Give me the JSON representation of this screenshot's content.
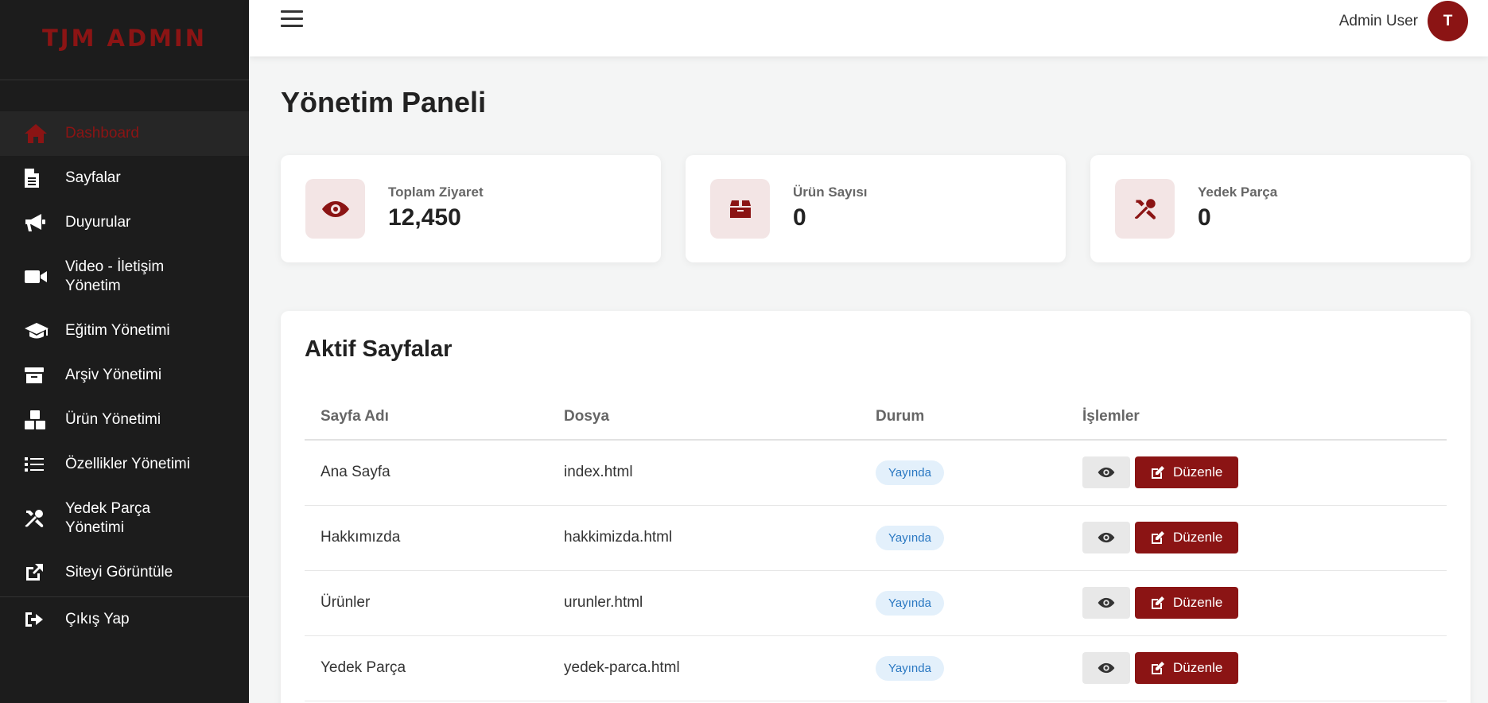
{
  "brand": "TJM ADMIN",
  "sidebar": {
    "items": [
      {
        "label": "Dashboard",
        "icon": "home-icon"
      },
      {
        "label": "Sayfalar",
        "icon": "file-icon"
      },
      {
        "label": "Duyurular",
        "icon": "megaphone-icon"
      },
      {
        "label": "Video - İletişim Yönetim",
        "icon": "video-icon"
      },
      {
        "label": "Eğitim Yönetimi",
        "icon": "graduation-cap-icon"
      },
      {
        "label": "Arşiv Yönetimi",
        "icon": "archive-icon"
      },
      {
        "label": "Ürün Yönetimi",
        "icon": "boxes-icon"
      },
      {
        "label": "Özellikler Yönetimi",
        "icon": "list-icon"
      },
      {
        "label": "Yedek Parça Yönetimi",
        "icon": "tools-icon"
      },
      {
        "label": "Siteyi Görüntüle",
        "icon": "external-link-icon"
      },
      {
        "label": "Çıkış Yap",
        "icon": "sign-out-icon"
      }
    ]
  },
  "header": {
    "user_name": "Admin User",
    "avatar_initial": "T"
  },
  "page_title": "Yönetim Paneli",
  "stats": [
    {
      "label": "Toplam Ziyaret",
      "value": "12,450",
      "icon": "eye-icon"
    },
    {
      "label": "Ürün Sayısı",
      "value": "0",
      "icon": "box-icon"
    },
    {
      "label": "Yedek Parça",
      "value": "0",
      "icon": "tools-icon"
    }
  ],
  "pages_panel": {
    "title": "Aktif Sayfalar",
    "columns": [
      "Sayfa Adı",
      "Dosya",
      "Durum",
      "İşlemler"
    ],
    "rows": [
      {
        "name": "Ana Sayfa",
        "file": "index.html",
        "status": "Yayında",
        "edit": "Düzenle"
      },
      {
        "name": "Hakkımızda",
        "file": "hakkimizda.html",
        "status": "Yayında",
        "edit": "Düzenle"
      },
      {
        "name": "Ürünler",
        "file": "urunler.html",
        "status": "Yayında",
        "edit": "Düzenle"
      },
      {
        "name": "Yedek Parça",
        "file": "yedek-parca.html",
        "status": "Yayında",
        "edit": "Düzenle"
      }
    ]
  },
  "colors": {
    "accent": "#8b1414",
    "sidebar_bg": "#1c1c1c",
    "badge_bg": "#e3f0fb",
    "badge_text": "#2a78c2"
  }
}
